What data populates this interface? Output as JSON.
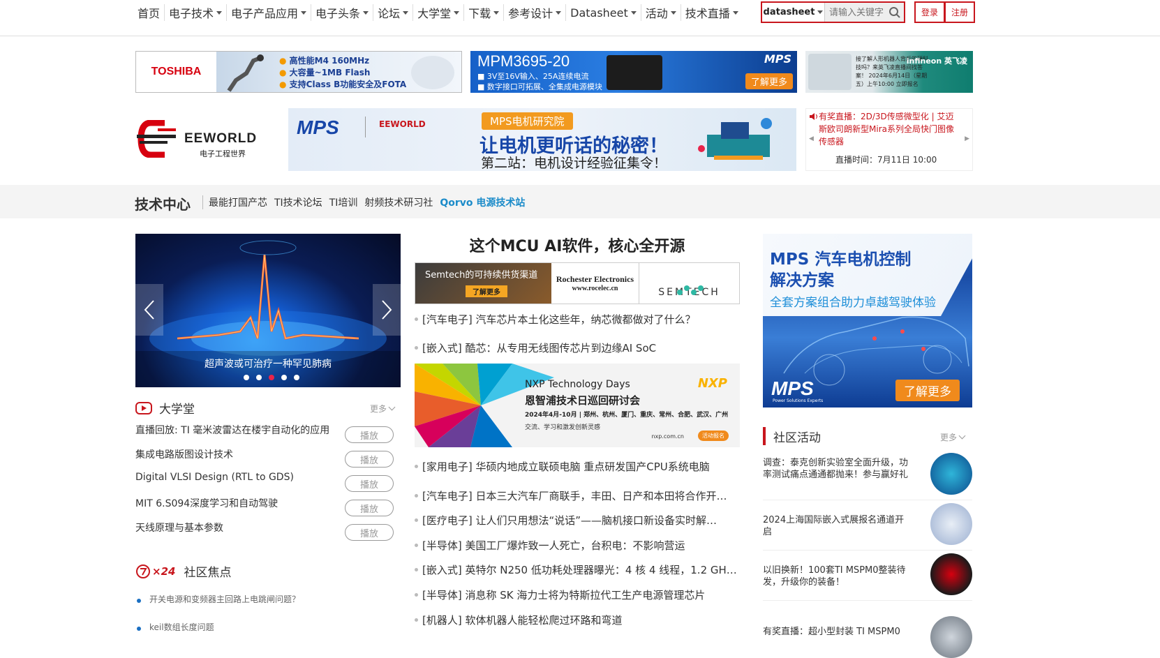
{
  "nav": {
    "items": [
      {
        "label": "首页",
        "caret": false
      },
      {
        "label": "电子技术",
        "caret": true
      },
      {
        "label": "电子产品应用",
        "caret": true
      },
      {
        "label": "电子头条",
        "caret": true
      },
      {
        "label": "论坛",
        "caret": true
      },
      {
        "label": "大学堂",
        "caret": true
      },
      {
        "label": "下载",
        "caret": true
      },
      {
        "label": "参考设计",
        "caret": true
      },
      {
        "label": "Datasheet",
        "caret": true
      },
      {
        "label": "活动",
        "caret": true
      },
      {
        "label": "技术直播",
        "caret": true
      }
    ],
    "search_select": "datasheet",
    "search_placeholder": "请输入关键字",
    "login": "登录",
    "register": "注册"
  },
  "ads": {
    "toshiba_logo": "TOSHIBA",
    "toshiba_bullets": [
      "高性能M4 160MHz",
      "大容量~1MB Flash",
      "支持Class B功能安全及FOTA"
    ],
    "mps_title": "MPM3695-20",
    "mps_lines": [
      "■ 3V至16V输入、25A连续电流",
      "■ 数字接口可拓展、全集成电源模块"
    ],
    "mps_button": "了解更多",
    "mps_brand": "MPS",
    "infineon_text": "接了解人形机器人背后的硬科技吗？来英飞凌直播间找答案！ 2024年6月14日（星期五）上午10:00 立即报名",
    "infineon_logo": "infineon 英飞凌"
  },
  "logo": {
    "name": "EEWORLD",
    "sub": "电子工程世界"
  },
  "banner": {
    "mps": "MPS",
    "eeworld": "EEWORLD",
    "pill": "MPS电机研究院",
    "big": "让电机更听话的秘密！",
    "small": "第二站：电机设计经验征集令！"
  },
  "live": {
    "title": "有奖直播：2D/3D传感微型化 | 艾迈斯欧司朗新型Mira系列全局快门图像传感器",
    "time": "直播时间：7月11日 10:00"
  },
  "tech_center": {
    "title": "技术中心",
    "links": [
      "最能打国产芯",
      "TI技术论坛",
      "TI培训",
      "射频技术研习社"
    ],
    "highlight": "Qorvo 电源技术站"
  },
  "carousel": {
    "caption": "超声波或可治疗一种罕见肺病",
    "dots": 5,
    "active": 2
  },
  "university": {
    "title": "大学堂",
    "more": "更多",
    "courses": [
      {
        "title": "直播回放: TI 毫米波雷达在楼宇自动化的应用",
        "btn": "播放"
      },
      {
        "title": "集成电路版图设计技术",
        "btn": "播放"
      },
      {
        "title": "Digital VLSI Design (RTL to GDS)",
        "btn": "播放"
      },
      {
        "title": "MIT 6.S094深度学习和自动驾驶",
        "btn": "播放"
      },
      {
        "title": "天线原理与基本参数",
        "btn": "播放"
      }
    ]
  },
  "community_focus": {
    "badge": "×24",
    "title": "社区焦点",
    "items": [
      "开关电源和变频器主回路上电跳闸问题？",
      "keil数组长度问题"
    ]
  },
  "middle": {
    "headline": "这个MCU AI软件，核心全开源",
    "semtech_text": "Semtech的可持续供货渠道",
    "semtech_btn": "了解更多",
    "rochester": "Rochester Electronics",
    "rochester_url": "www.rocelec.cn",
    "semtech_logo": "SEMTECH",
    "news_top": [
      "[汽车电子] 汽车芯片本土化这些年，纳芯微都做对了什么？",
      "[嵌入式] 酷芯：从专用无线图传芯片到边缘AI SoC"
    ],
    "nxp": {
      "t1": "NXP Technology Days",
      "t2": "恩智浦技术日巡回研讨会",
      "t3": "2024年4月-10月 | 郑州、杭州、厦门、重庆、常州、合肥、武汉、广州",
      "t4": "交流、学习和激发创新灵感",
      "logo": "NXP",
      "url": "nxp.com.cn",
      "btn": "活动报名"
    },
    "news_bottom": [
      "[家用电子] 华硕内地成立联硕电脑 重点研发国产CPU系统电脑",
      "[汽车电子] 日本三大汽车厂商联手，丰田、日产和本田将合作开…",
      "[医疗电子] 让人们只用想法“说话”——脑机接口新设备实时解…",
      "[半导体] 美国工厂爆炸致一人死亡，台积电：不影响营运",
      "[嵌入式] 英特尔 N250 低功耗处理器曝光：4 核 4 线程，1.2 GH…",
      "[半导体] 消息称 SK 海力士将为特斯拉代工生产电源管理芯片",
      "[机器人] 软体机器人能轻松爬过环路和弯道"
    ]
  },
  "right": {
    "ad_title": "MPS 汽车电机控制解决方案",
    "ad_title_l1": "MPS 汽车电机控制",
    "ad_title_l2": "解决方案",
    "ad_sub": "全套方案组合助力卓越驾驶体验",
    "ad_logo": "MPS",
    "ad_logo_sub": "Power Solutions Experts",
    "ad_btn": "了解更多",
    "community_title": "社区活动",
    "more": "更多",
    "activities": [
      "调查：泰克创新实验室全面升级，功率测试痛点通通都抛来！参与赢好礼",
      "2024上海国际嵌入式展报名通道开启",
      "以旧换新！100套TI MSPM0整装待发，升级你的装备！",
      "有奖直播：超小型封装 TI MSPM0"
    ]
  },
  "colors": {
    "brand_red": "#c8161d",
    "accent_blue": "#1b8bc9",
    "orange": "#f08a1c"
  }
}
